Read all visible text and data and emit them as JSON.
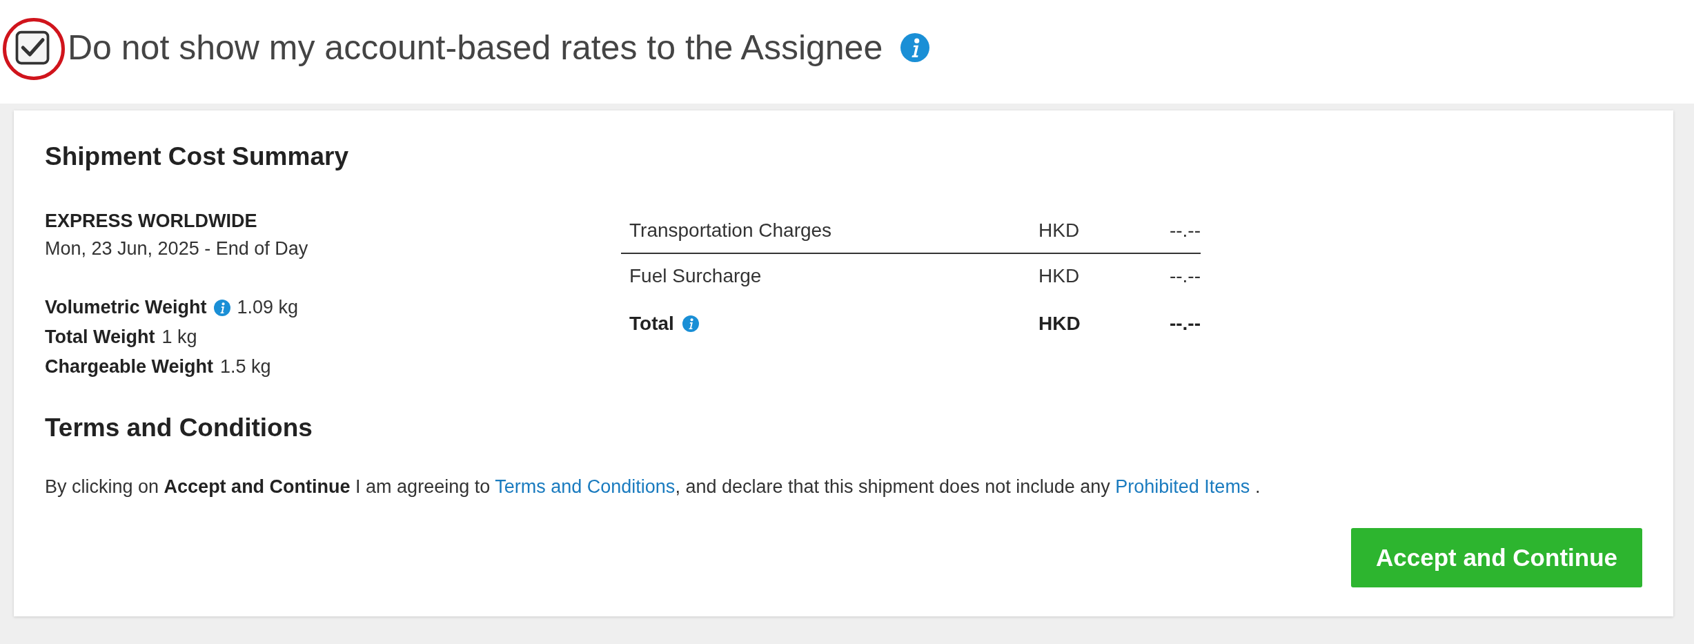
{
  "assignee_option": {
    "checked": true,
    "highlighted": true,
    "label": "Do not show my account-based rates to the Assignee"
  },
  "summary": {
    "title": "Shipment Cost Summary",
    "service": "EXPRESS WORLDWIDE",
    "delivery": "Mon, 23 Jun, 2025 - End of Day",
    "weights": [
      {
        "label": "Volumetric Weight",
        "info": true,
        "value": "1.09 kg"
      },
      {
        "label": "Total Weight",
        "info": false,
        "value": "1 kg"
      },
      {
        "label": "Chargeable Weight",
        "info": false,
        "value": "1.5 kg"
      }
    ],
    "charges": [
      {
        "kind": "charge",
        "label": "Transportation Charges",
        "info": false,
        "currency": "HKD",
        "amount": "--.--"
      },
      {
        "kind": "charge",
        "label": "Fuel Surcharge",
        "info": false,
        "currency": "HKD",
        "amount": "--.--"
      },
      {
        "kind": "total",
        "label": "Total",
        "info": true,
        "currency": "HKD",
        "amount": "--.--"
      }
    ]
  },
  "terms": {
    "title": "Terms and Conditions",
    "sentence": [
      {
        "kind": "text",
        "text": "By clicking on **Accept and Continue** I am agreeing to "
      },
      {
        "kind": "link",
        "text": "Terms and Conditions"
      },
      {
        "kind": "text",
        "text": ", and declare that this shipment does not include any "
      },
      {
        "kind": "link",
        "text": "Prohibited Items"
      },
      {
        "kind": "text",
        "text": " ."
      }
    ]
  },
  "buttons": [
    {
      "label": "Accept and Continue"
    }
  ]
}
